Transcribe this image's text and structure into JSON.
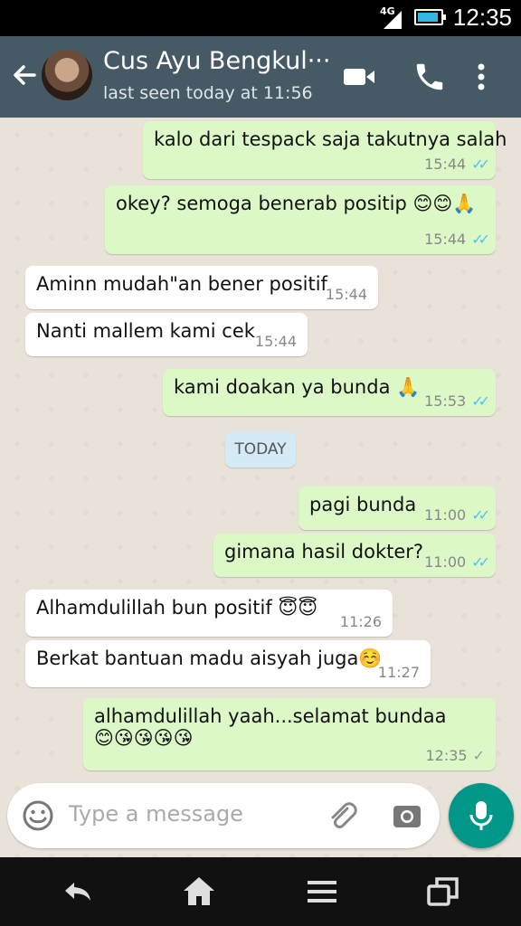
{
  "status_bar": {
    "network": "4G",
    "time": "12:35"
  },
  "header": {
    "contact_name": "Cus Ayu Bengkul···",
    "last_seen": "last seen today at 11:56",
    "icons": [
      "back-arrow-icon",
      "avatar",
      "video-call-icon",
      "phone-icon",
      "more-vert-icon"
    ]
  },
  "messages": [
    {
      "dir": "out",
      "text": "kalo dari tespack saja takutnya salah",
      "time": "15:44",
      "status": "read"
    },
    {
      "dir": "out",
      "text": "okey? semoga benerab positip 😊😊🙏",
      "time": "15:44",
      "status": "read"
    },
    {
      "dir": "in",
      "text": "Aminn mudah\"an bener positif",
      "time": "15:44"
    },
    {
      "dir": "in",
      "text": "Nanti mallem kami cek",
      "time": "15:44"
    },
    {
      "dir": "out",
      "text": "kami doakan ya bunda 🙏",
      "time": "15:53",
      "status": "read"
    },
    {
      "dir": "out",
      "text": "pagi bunda",
      "time": "11:00",
      "status": "read"
    },
    {
      "dir": "out",
      "text": "gimana hasil dokter?",
      "time": "11:00",
      "status": "read"
    },
    {
      "dir": "in",
      "text": "Alhamdulillah bun positif 😇😇",
      "time": "11:26"
    },
    {
      "dir": "in",
      "text": "Berkat bantuan madu aisyah juga☺️",
      "time": "11:27"
    },
    {
      "dir": "out",
      "text": "alhamdulillah yaah...selamat bundaa",
      "text2": "😊😘😘😘😘",
      "time": "12:35",
      "status": "sent"
    }
  ],
  "date_chip": "TODAY",
  "composer": {
    "placeholder": "Type a message"
  },
  "colors": {
    "header": "#455a64",
    "outgoing": "#dcf8c6",
    "incoming": "#ffffff",
    "fab": "#009688",
    "read_ticks": "#4fc3f7"
  }
}
